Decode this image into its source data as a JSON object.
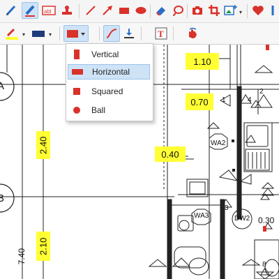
{
  "colors": {
    "accent": "#d9322b",
    "highlight": "#ffff33",
    "selection": "#cfe3f7"
  },
  "toolbar_top": {
    "items": [
      {
        "name": "pen-icon"
      },
      {
        "name": "highlighter-icon"
      },
      {
        "name": "text-field-icon"
      },
      {
        "name": "stamp-icon"
      },
      {
        "name": "line-icon"
      },
      {
        "name": "arrow-icon"
      },
      {
        "name": "rectangle-icon"
      },
      {
        "name": "ellipse-icon"
      },
      {
        "name": "eraser-icon"
      },
      {
        "name": "lasso-icon"
      },
      {
        "name": "camera-icon"
      },
      {
        "name": "crop-icon"
      },
      {
        "name": "image-add-icon"
      },
      {
        "name": "heart-icon"
      }
    ]
  },
  "toolbar_sub": {
    "items": [
      {
        "name": "pen-color-icon"
      },
      {
        "name": "fill-color-icon"
      },
      {
        "name": "shape-style-icon"
      },
      {
        "name": "curve-icon"
      },
      {
        "name": "align-icon"
      },
      {
        "name": "text-style-icon"
      },
      {
        "name": "hand-icon"
      }
    ]
  },
  "shape_menu": {
    "items": [
      {
        "label": "Vertical",
        "icon": "vertical-bar-icon"
      },
      {
        "label": "Horizontal",
        "icon": "horizontal-bar-icon",
        "selected": true
      },
      {
        "label": "Squared",
        "icon": "square-icon"
      },
      {
        "label": "Ball",
        "icon": "ball-icon"
      }
    ]
  },
  "drawing": {
    "grid_labels": [
      "A",
      "B"
    ],
    "dimensions": [
      "1.10",
      "0.70",
      "2.40",
      "0.40",
      "2.10",
      "7.40",
      "0.30"
    ],
    "room_tags": [
      "WA2",
      "WA3",
      "DW2"
    ],
    "triangle_numbers": [
      "1",
      "2",
      "3",
      "4",
      "8"
    ]
  }
}
